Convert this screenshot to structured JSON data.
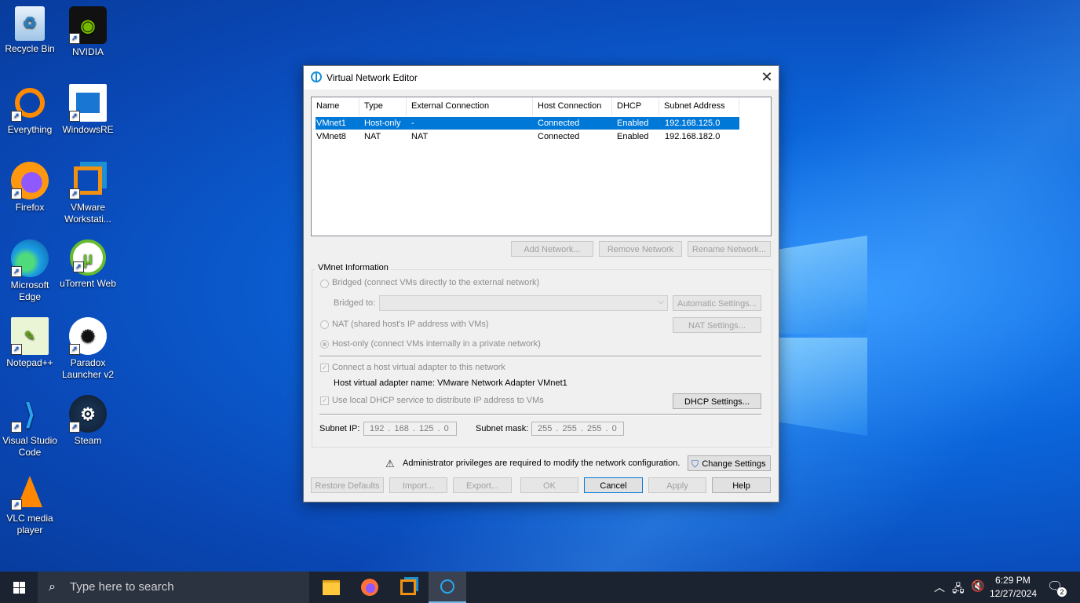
{
  "desktop": {
    "icons": [
      {
        "label": "Recycle Bin",
        "icon": "recycle-bin-icon"
      },
      {
        "label": "NVIDIA",
        "icon": "nvidia-icon"
      },
      {
        "label": "Everything",
        "icon": "everything-search-icon"
      },
      {
        "label": "WindowsRE",
        "icon": "windowsre-icon"
      },
      {
        "label": "Firefox",
        "icon": "firefox-icon"
      },
      {
        "label": "VMware Workstati...",
        "icon": "vmware-icon"
      },
      {
        "label": "Microsoft Edge",
        "icon": "edge-icon"
      },
      {
        "label": "uTorrent Web",
        "icon": "utorrent-icon"
      },
      {
        "label": "Notepad++",
        "icon": "notepadpp-icon"
      },
      {
        "label": "Paradox Launcher v2",
        "icon": "paradox-icon"
      },
      {
        "label": "Visual Studio Code",
        "icon": "vscode-icon"
      },
      {
        "label": "Steam",
        "icon": "steam-icon"
      },
      {
        "label": "VLC media player",
        "icon": "vlc-icon"
      }
    ]
  },
  "dialog": {
    "title": "Virtual Network Editor",
    "close": "✕",
    "columns": [
      "Name",
      "Type",
      "External Connection",
      "Host Connection",
      "DHCP",
      "Subnet Address"
    ],
    "rows": [
      {
        "name": "VMnet1",
        "type": "Host-only",
        "external": "-",
        "host": "Connected",
        "dhcp": "Enabled",
        "subnet": "192.168.125.0",
        "selected": true
      },
      {
        "name": "VMnet8",
        "type": "NAT",
        "external": "NAT",
        "host": "Connected",
        "dhcp": "Enabled",
        "subnet": "192.168.182.0",
        "selected": false
      }
    ],
    "add_network": "Add Network...",
    "remove_network": "Remove Network",
    "rename_network": "Rename Network...",
    "vmnet_info": "VMnet Information",
    "bridged": "Bridged (connect VMs directly to the external network)",
    "bridged_to": "Bridged to:",
    "automatic_settings": "Automatic Settings...",
    "nat": "NAT (shared host's IP address with VMs)",
    "nat_settings": "NAT Settings...",
    "host_only": "Host-only (connect VMs internally in a private network)",
    "connect_adapter": "Connect a host virtual adapter to this network",
    "adapter_name": "Host virtual adapter name: VMware Network Adapter VMnet1",
    "use_dhcp": "Use local DHCP service to distribute IP address to VMs",
    "dhcp_settings": "DHCP Settings...",
    "subnet_ip_label": "Subnet IP:",
    "subnet_ip": "192 . 168 . 125 .   0",
    "subnet_mask_label": "Subnet mask:",
    "subnet_mask": "255 . 255 . 255 .   0",
    "admin_note": "Administrator privileges are required to modify the network configuration.",
    "change_settings": "Change Settings",
    "restore_defaults": "Restore Defaults",
    "import": "Import...",
    "export": "Export...",
    "ok": "OK",
    "cancel": "Cancel",
    "apply": "Apply",
    "help": "Help"
  },
  "taskbar": {
    "search_placeholder": "Type here to search",
    "apps": [
      "file-explorer-icon",
      "firefox-icon",
      "vmware-icon",
      "virtual-network-editor-icon"
    ],
    "time": "6:29 PM",
    "date": "12/27/2024",
    "notification_count": "2"
  }
}
